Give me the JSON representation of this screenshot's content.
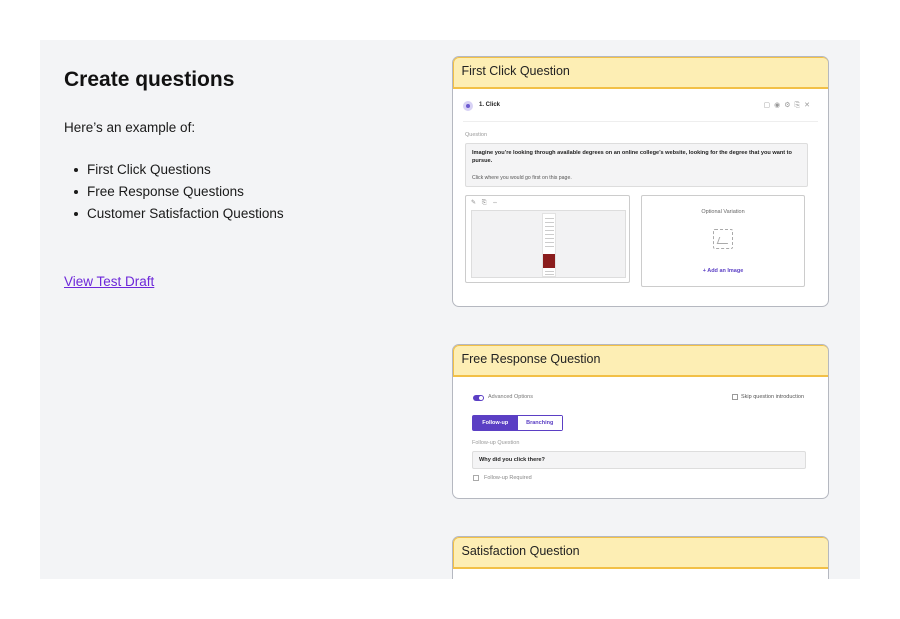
{
  "left": {
    "title": "Create questions",
    "intro": "Here’s an example of:",
    "bullets": [
      "First Click Questions",
      "Free Response Questions",
      "Customer Satisfaction Questions"
    ],
    "link_label": "View Test Draft"
  },
  "cards": {
    "first_click": {
      "header": "First Click Question",
      "block_label": "1. Click",
      "question_label": "Question",
      "question_text": "Imagine you’re looking through available degrees on an online college’s website, looking for the degree that you want to pursue.",
      "question_sub": "Click where you would go first on this page.",
      "optional_variation": "Optional Variation",
      "add_image": "+ Add an Image"
    },
    "free_response": {
      "header": "Free Response Question",
      "advanced_options": "Advanced Options",
      "skip_intro": "Skip question introduction",
      "tab_followup": "Follow-up",
      "tab_branching": "Branching",
      "followup_label": "Follow-up Question",
      "followup_value": "Why did you click there?",
      "followup_required": "Follow-up Required"
    },
    "satisfaction": {
      "header": "Satisfaction Question"
    }
  },
  "colors": {
    "accent": "#5b3fc4",
    "link": "#6d28d9",
    "card_header_bg": "#fdeeb4",
    "card_header_border": "#f2c047",
    "panel_bg": "#f3f4f6"
  },
  "icons": [
    "avatar-icon",
    "edit-icon",
    "image-placeholder-icon",
    "toggle-icon",
    "checkbox-icon"
  ]
}
